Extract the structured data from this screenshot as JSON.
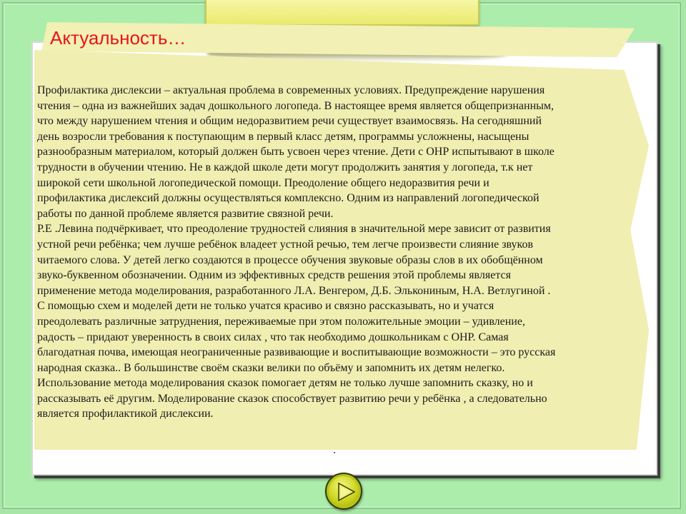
{
  "slide": {
    "title": "Актуальность…",
    "paragraphs": [
      "Профилактика дислексии – актуальная проблема в современных  условиях. Предупреждение нарушения\nчтения – одна из важнейших задач дошкольного логопеда. В настоящее время является общепризнанным,\nчто между  нарушением чтения и общим недоразвитием речи существует взаимосвязь. На сегодняшний\nдень возросли требования к поступающим в первый класс  детям, программы усложнены, насыщены\nразнообразным материалом, который должен быть усвоен через чтение. Дети с ОНР испытывают в школе\nтрудности в обучении чтению. Не в каждой школе дети могут продолжить занятия у логопеда, т.к нет\nширокой сети школьной логопедической помощи. Преодоление общего недоразвития речи и\nпрофилактика дислексий должны осуществляться комплексно. Одним из направлений логопедической\nработы по данной проблеме является развитие связной  речи.",
      "Р.Е .Левина подчёркивает, что преодоление трудностей слияния в значительной мере зависит от развития\nустной речи ребёнка; чем лучше ребёнок владеет устной речью, тем легче произвести слияние звуков\nчитаемого слова.  У детей легко создаются в процессе обучения звуковые образы слов в их обобщённом\nзвуко-буквенном обозначении. Одним из эффективных средств решения этой проблемы является\nприменение  метода моделирования, разработанного Л.А. Венгером, Д.Б. Элькониным, Н.А. Ветлугиной .\nС помощью схем и моделей дети  не только учатся красиво и связно рассказывать, но и учатся\nпреодолевать различные затруднения, переживаемые при этом положительные эмоции – удивление,\nрадость – придают уверенность в своих силах , что так необходимо дошкольникам с ОНР. Самая\nблагодатная почва, имеющая неограниченные развивающие и воспитывающие возможности – это русская\nнародная сказка.. В большинстве своём сказки велики по объёму и запомнить их детям нелегко.\nИспользование метода моделирования сказок помогает детям не только лучше запомнить сказку, но  и\nрассказывать её другим. Моделирование сказок способствует развитию речи  у ребёнка , а следовательно\nявляется профилактикой дислексии."
    ],
    "trailing_mark": "."
  },
  "navigation": {
    "next_icon": "play-triangle-icon"
  },
  "colors": {
    "background": "#a8e6a8",
    "note_paper": "#f0eeb1",
    "title_text": "#e8141c",
    "tab": "#eeee80",
    "button": "#c9d11a"
  }
}
